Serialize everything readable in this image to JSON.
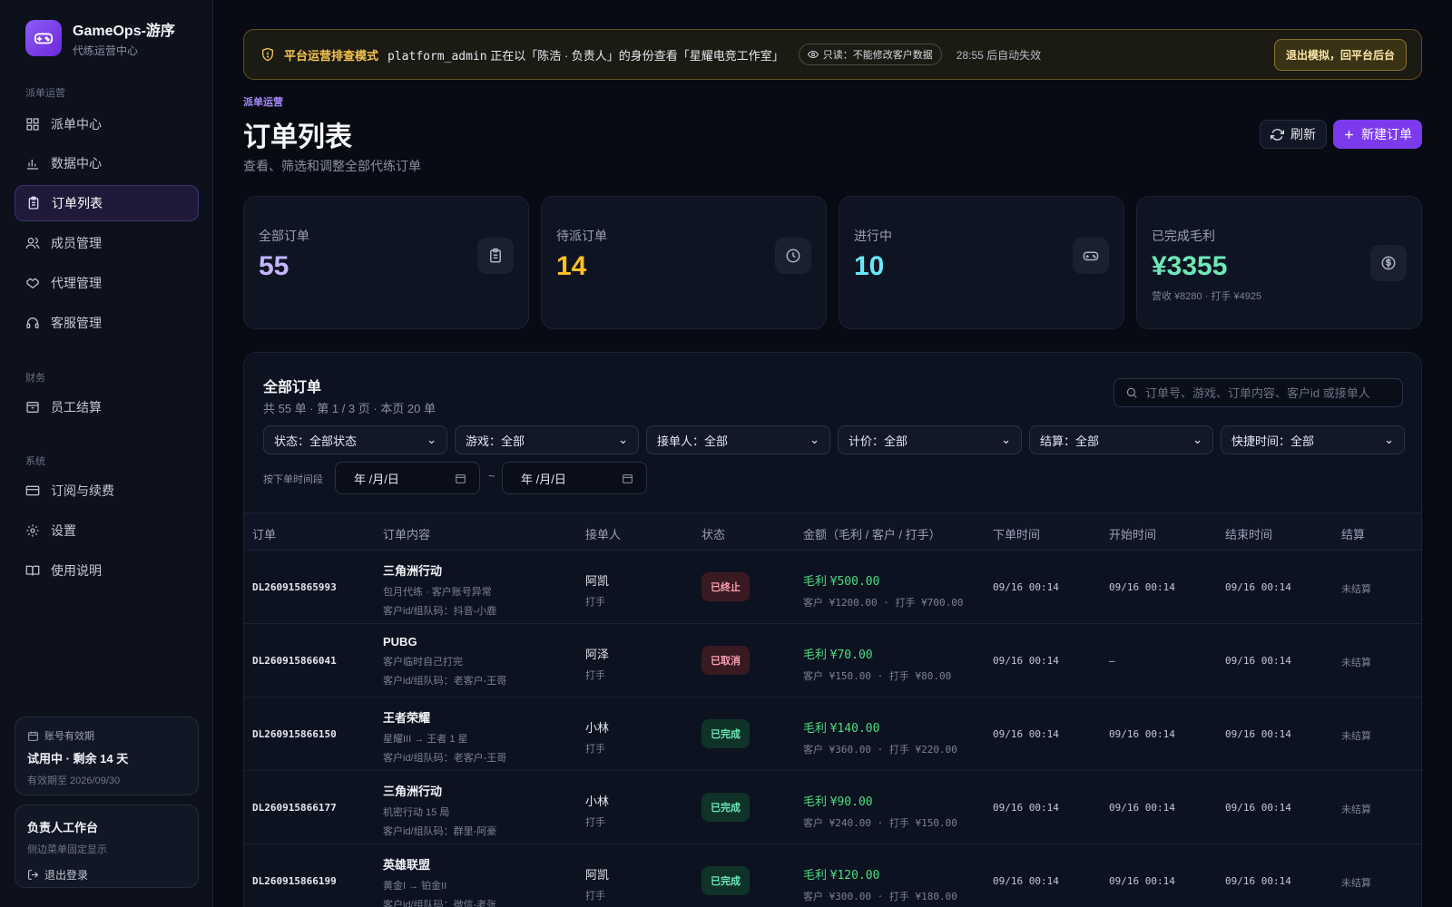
{
  "brand": {
    "name": "GameOps-游序",
    "subtitle": "代练运营中心"
  },
  "sidebar": {
    "sections": [
      {
        "title": "派单运营"
      },
      {
        "title": "财务"
      },
      {
        "title": "系统"
      }
    ],
    "items": [
      {
        "label": "派单中心",
        "icon": "grid-icon"
      },
      {
        "label": "数据中心",
        "icon": "bar-chart-icon"
      },
      {
        "label": "订单列表",
        "icon": "clipboard-icon",
        "active": true
      },
      {
        "label": "成员管理",
        "icon": "users-icon"
      },
      {
        "label": "代理管理",
        "icon": "handshake-icon"
      },
      {
        "label": "客服管理",
        "icon": "headset-icon"
      },
      {
        "label": "员工结算",
        "icon": "archive-icon"
      },
      {
        "label": "订阅与续费",
        "icon": "credit-card-icon"
      },
      {
        "label": "设置",
        "icon": "gear-icon"
      },
      {
        "label": "使用说明",
        "icon": "book-icon"
      }
    ],
    "expiry": {
      "label": "账号有效期",
      "status": "试用中 · 剩余 14 天",
      "until": "有效期至 2026/09/30"
    },
    "owner": {
      "title": "负责人工作台",
      "subtitle": "侧边菜单固定显示",
      "logout": "退出登录"
    }
  },
  "banner": {
    "title": "平台运营排查模式",
    "user": "platform_admin",
    "text": "正在以「陈浩 · 负责人」的身份查看「星耀电竞工作室」",
    "readonly": "只读：不能修改客户数据",
    "timer": "28:55 后自动失效",
    "exit_label": "退出模拟，回平台后台"
  },
  "page": {
    "eyebrow": "派单运营",
    "title": "订单列表",
    "subtitle": "查看、筛选和调整全部代练订单",
    "refresh_label": "刷新",
    "new_label": "新建订单"
  },
  "stats": [
    {
      "label": "全部订单",
      "value": "55",
      "color": "#c4b5fd",
      "icon": "clipboard-icon"
    },
    {
      "label": "待派订单",
      "value": "14",
      "color": "#fbbf24",
      "icon": "clock-icon"
    },
    {
      "label": "进行中",
      "value": "10",
      "color": "#67e8f9",
      "icon": "gamepad-icon"
    },
    {
      "label": "已完成毛利",
      "value": "¥3355",
      "color": "#6ee7b7",
      "foot": "营收 ¥8280 · 打手 ¥4925",
      "icon": "dollar-icon"
    }
  ],
  "panel": {
    "title": "全部订单",
    "summary": "共 55 单 · 第 1 / 3 页 · 本页 20 单",
    "search_placeholder": "订单号、游戏、订单内容、客户id 或接单人",
    "filters": [
      "状态：全部状态",
      "游戏：全部",
      "接单人：全部",
      "计价：全部",
      "结算：全部",
      "快捷时间：全部"
    ],
    "date_label": "按下单时间段",
    "date_placeholder": "年 /月/日",
    "date_sep": "~"
  },
  "table": {
    "columns": [
      "订单",
      "订单内容",
      "接单人",
      "状态",
      "金额（毛利 / 客户 / 打手）",
      "下单时间",
      "开始时间",
      "结束时间",
      "结算"
    ],
    "rows": [
      {
        "id": "DL260915865993",
        "game": "三角洲行动",
        "desc": "包月代练 · 客户账号异常",
        "cust": "客户id/组队码：抖音-小鹿",
        "taker": "阿凯",
        "role": "打手",
        "status": "已终止",
        "status_kind": "st-terminated",
        "margin": "¥500.00",
        "detail": "客户 ¥1200.00 · 打手 ¥700.00",
        "ordered": "09/16 00:14",
        "start": "09/16 00:14",
        "end": "09/16 00:14",
        "settle": "未结算"
      },
      {
        "id": "DL260915866041",
        "game": "PUBG",
        "desc": "客户临时自己打完",
        "cust": "客户id/组队码：老客户-王哥",
        "taker": "阿泽",
        "role": "打手",
        "status": "已取消",
        "status_kind": "st-cancelled",
        "margin": "¥70.00",
        "detail": "客户 ¥150.00 · 打手 ¥80.00",
        "ordered": "09/16 00:14",
        "start": "—",
        "end": "09/16 00:14",
        "settle": "未结算"
      },
      {
        "id": "DL260915866150",
        "game": "王者荣耀",
        "desc": "星耀III → 王者 1 星",
        "cust": "客户id/组队码：老客户-王哥",
        "taker": "小林",
        "role": "打手",
        "status": "已完成",
        "status_kind": "st-done",
        "margin": "¥140.00",
        "detail": "客户 ¥360.00 · 打手 ¥220.00",
        "ordered": "09/16 00:14",
        "start": "09/16 00:14",
        "end": "09/16 00:14",
        "settle": "未结算"
      },
      {
        "id": "DL260915866177",
        "game": "三角洲行动",
        "desc": "机密行动 15 局",
        "cust": "客户id/组队码：群里-阿豪",
        "taker": "小林",
        "role": "打手",
        "status": "已完成",
        "status_kind": "st-done",
        "margin": "¥90.00",
        "detail": "客户 ¥240.00 · 打手 ¥150.00",
        "ordered": "09/16 00:14",
        "start": "09/16 00:14",
        "end": "09/16 00:14",
        "settle": "未结算"
      },
      {
        "id": "DL260915866199",
        "game": "英雄联盟",
        "desc": "黄金I → 铂金II",
        "cust": "客户id/组队码：微信-老张",
        "taker": "阿凯",
        "role": "打手",
        "status": "已完成",
        "status_kind": "st-done",
        "margin": "¥120.00",
        "detail": "客户 ¥300.00 · 打手 ¥180.00",
        "ordered": "09/16 00:14",
        "start": "09/16 00:14",
        "end": "09/16 00:14",
        "settle": "未结算"
      }
    ],
    "margin_prefix": "毛利"
  }
}
